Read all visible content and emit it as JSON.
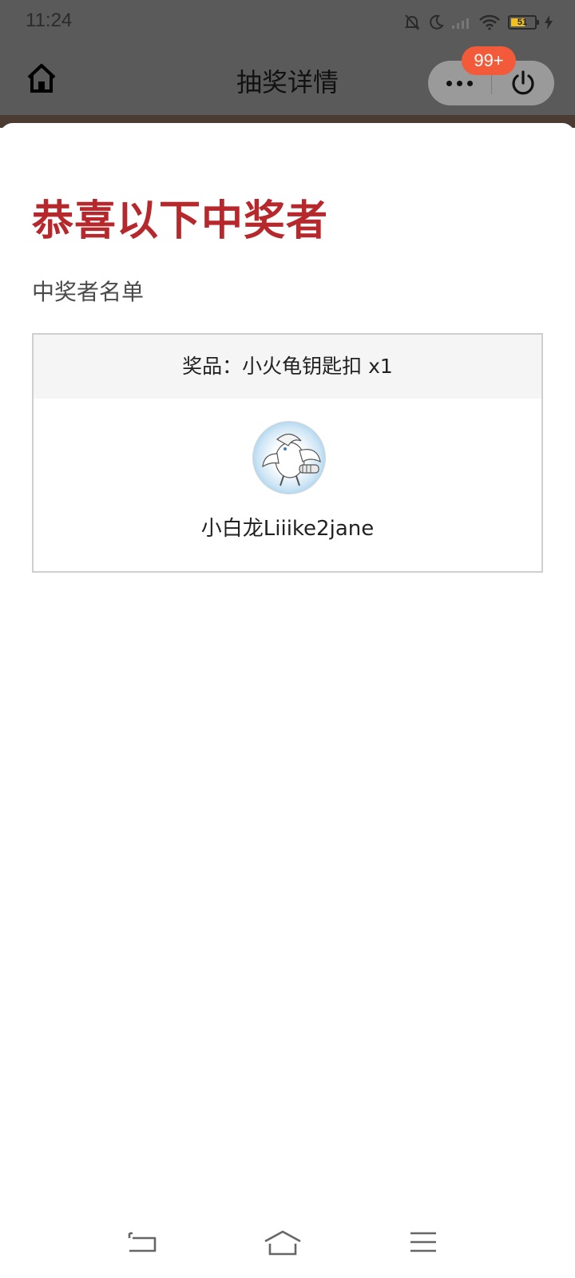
{
  "status_bar": {
    "time": "11:24",
    "battery_level": "51",
    "icons": [
      "mute-bell-icon",
      "moon-icon",
      "signal-icon",
      "wifi-icon",
      "battery-icon",
      "charging-icon"
    ]
  },
  "header": {
    "title": "抽奖详情",
    "badge": "99+",
    "icons": [
      "home-icon",
      "more-icon",
      "power-icon"
    ]
  },
  "content": {
    "congrats_title": "恭喜以下中奖者",
    "winners_label": "中奖者名单",
    "prize": {
      "label": "奖品：小火龟钥匙扣 x1"
    },
    "winner": {
      "name": "小白龙Liiike2jane"
    }
  },
  "colors": {
    "accent_red": "#b6282b",
    "badge": "#f25a3a",
    "overlay": "#5a5a5a"
  },
  "system_nav": {
    "icons": [
      "back-icon",
      "home-outline-icon",
      "menu-icon"
    ]
  }
}
